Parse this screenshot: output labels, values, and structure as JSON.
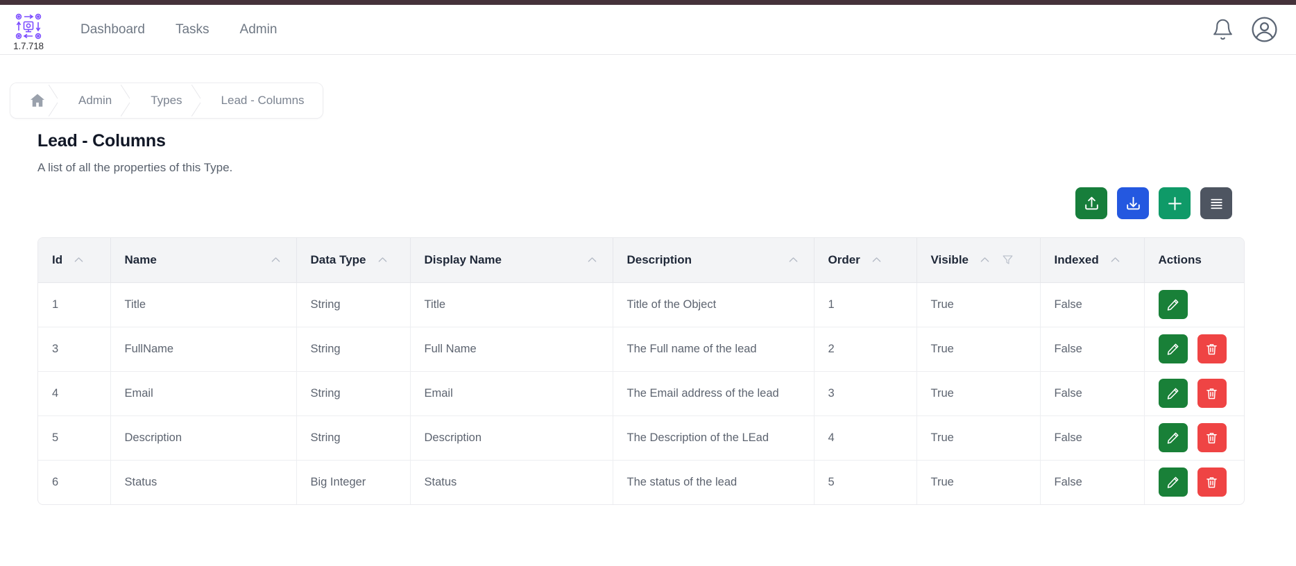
{
  "brand": {
    "logo_icon": "workflow-gears-icon",
    "version": "1.7.718"
  },
  "navbar": {
    "links": [
      {
        "label": "Dashboard"
      },
      {
        "label": "Tasks"
      },
      {
        "label": "Admin"
      }
    ],
    "notifications_icon": "bell-icon",
    "account_icon": "user-avatar-icon"
  },
  "breadcrumb": {
    "home_icon": "home-icon",
    "items": [
      {
        "label": "Admin"
      },
      {
        "label": "Types"
      },
      {
        "label": "Lead - Columns"
      }
    ]
  },
  "page": {
    "title": "Lead - Columns",
    "subtitle": "A list of all the properties of this Type."
  },
  "toolbar": {
    "buttons": [
      {
        "name": "upload",
        "icon": "upload-icon",
        "color": "#177e3b"
      },
      {
        "name": "download",
        "icon": "download-icon",
        "color": "#2458e0"
      },
      {
        "name": "add",
        "icon": "plus-icon",
        "color": "#0f9a68"
      },
      {
        "name": "menu",
        "icon": "hamburger-menu-icon",
        "color": "#4e5561"
      }
    ]
  },
  "table": {
    "columns": [
      {
        "label": "Id",
        "sortable": true,
        "filterable": false
      },
      {
        "label": "Name",
        "sortable": true,
        "filterable": false
      },
      {
        "label": "Data Type",
        "sortable": true,
        "filterable": false
      },
      {
        "label": "Display Name",
        "sortable": true,
        "filterable": false
      },
      {
        "label": "Description",
        "sortable": true,
        "filterable": false
      },
      {
        "label": "Order",
        "sortable": true,
        "filterable": false
      },
      {
        "label": "Visible",
        "sortable": true,
        "filterable": true
      },
      {
        "label": "Indexed",
        "sortable": true,
        "filterable": false
      },
      {
        "label": "Actions",
        "sortable": false,
        "filterable": false
      }
    ],
    "rows": [
      {
        "id": "1",
        "name": "Title",
        "data_type": "String",
        "display_name": "Title",
        "description": "Title of the Object",
        "order": "1",
        "visible": "True",
        "indexed": "False",
        "has_edit": true,
        "has_delete": false
      },
      {
        "id": "3",
        "name": "FullName",
        "data_type": "String",
        "display_name": "Full Name",
        "description": "The Full name of the lead",
        "order": "2",
        "visible": "True",
        "indexed": "False",
        "has_edit": true,
        "has_delete": true
      },
      {
        "id": "4",
        "name": "Email",
        "data_type": "String",
        "display_name": "Email",
        "description": "The Email address of the lead",
        "order": "3",
        "visible": "True",
        "indexed": "False",
        "has_edit": true,
        "has_delete": true
      },
      {
        "id": "5",
        "name": "Description",
        "data_type": "String",
        "display_name": "Description",
        "description": "The Description of the LEad",
        "order": "4",
        "visible": "True",
        "indexed": "False",
        "has_edit": true,
        "has_delete": true
      },
      {
        "id": "6",
        "name": "Status",
        "data_type": "Big Integer",
        "display_name": "Status",
        "description": "The status of the lead",
        "order": "5",
        "visible": "True",
        "indexed": "False",
        "has_edit": true,
        "has_delete": true
      }
    ]
  },
  "colors": {
    "top_strip": "#45323a",
    "brand_purple": "#7c4dff",
    "edit_green": "#198038",
    "delete_red": "#ef4444"
  }
}
